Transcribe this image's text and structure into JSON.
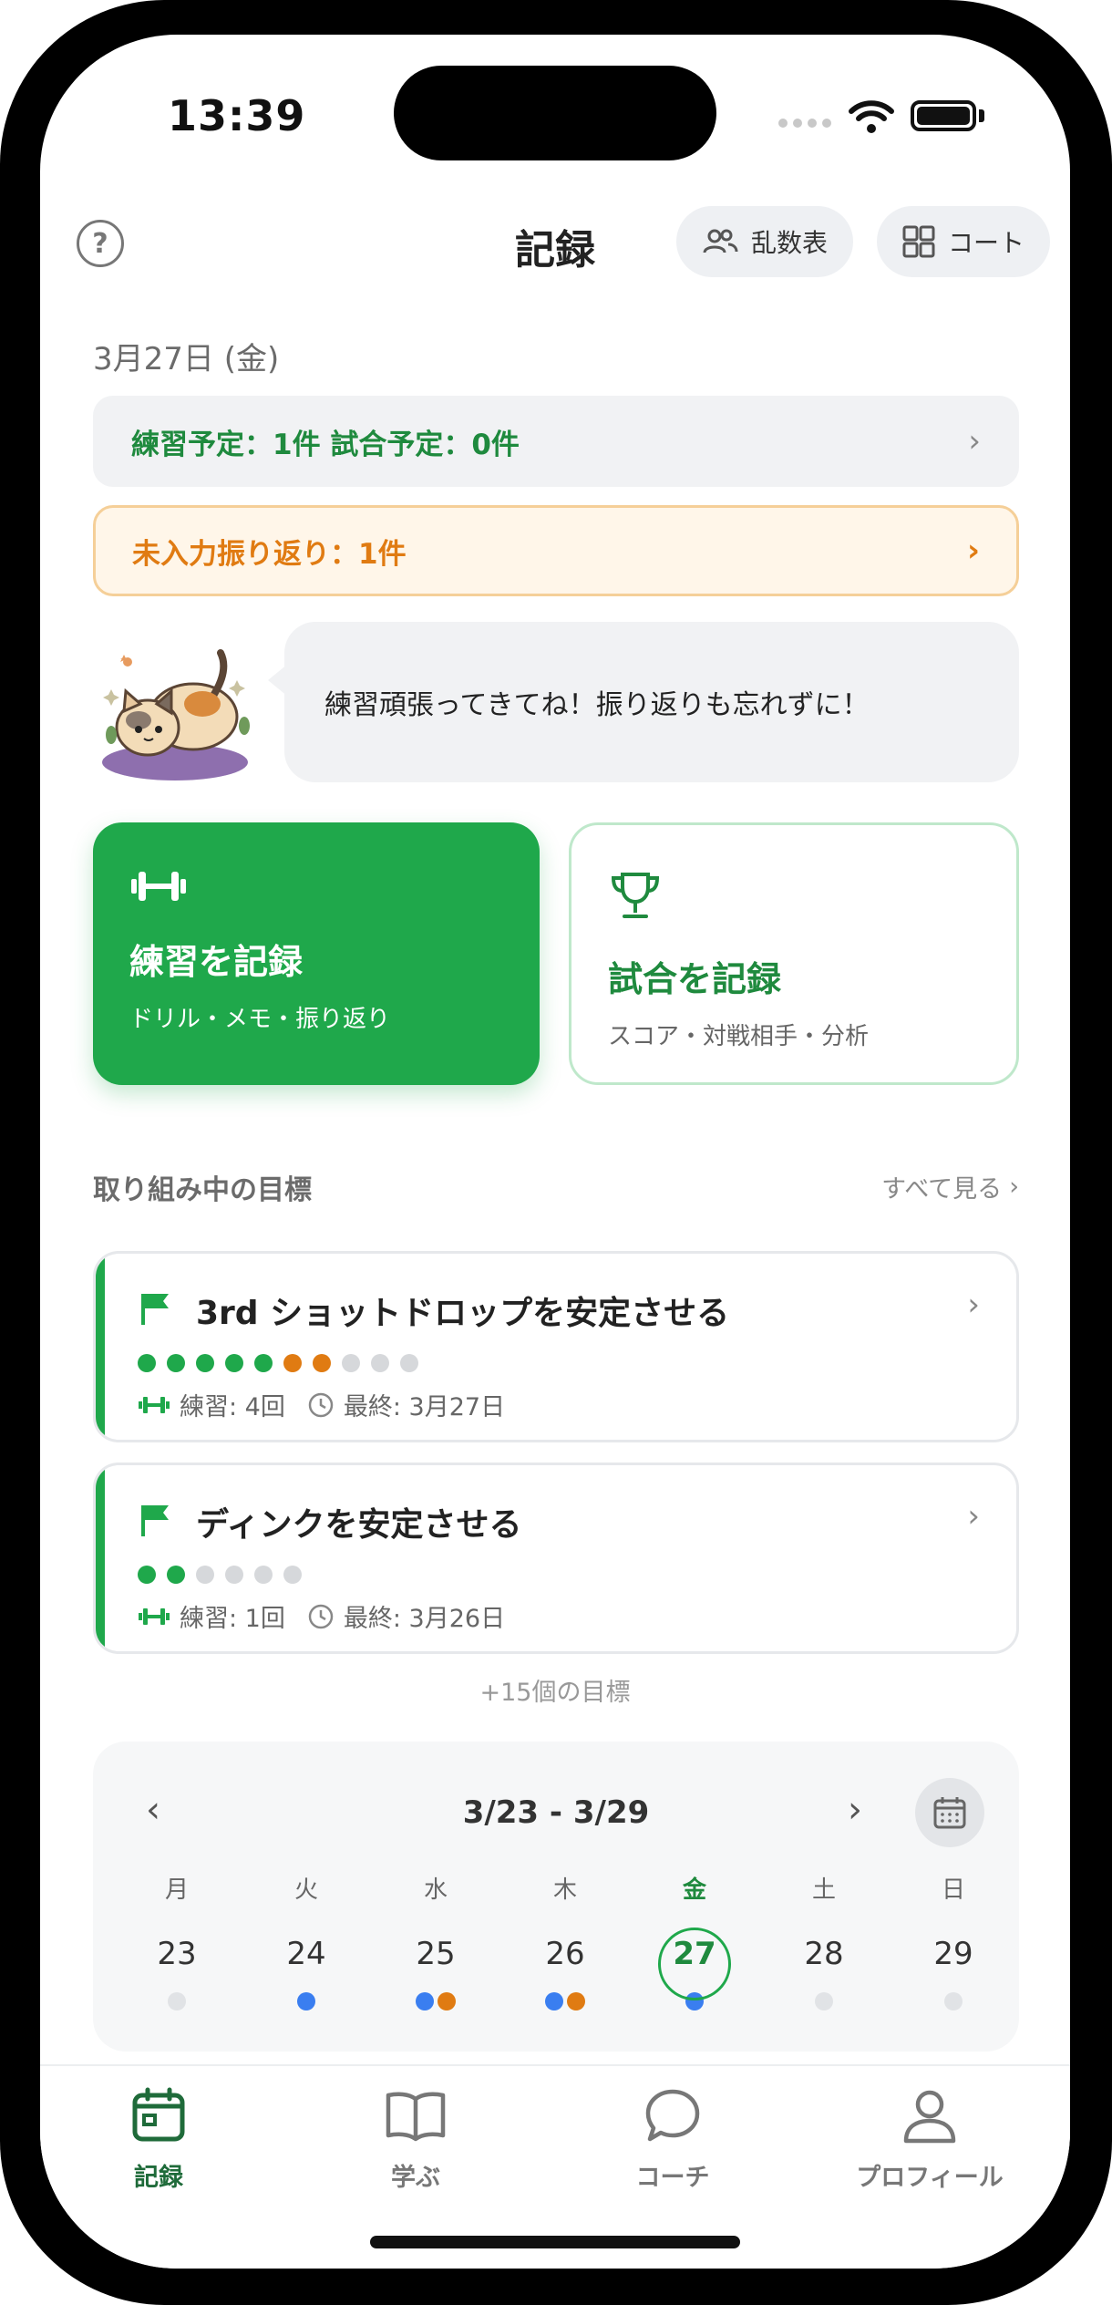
{
  "status": {
    "time": "13:39"
  },
  "header": {
    "title": "記録",
    "random_table_label": "乱数表",
    "court_label": "コート"
  },
  "date_label": "3月27日 (金)",
  "schedule_banner": "練習予定：1件  試合予定：0件",
  "reflection_banner": "未入力振り返り：1件",
  "mascot_message": "練習頑張ってきてね！振り返りも忘れずに！",
  "actions": {
    "practice": {
      "title": "練習を記録",
      "subtitle": "ドリル・メモ・振り返り"
    },
    "match": {
      "title": "試合を記録",
      "subtitle": "スコア・対戦相手・分析"
    }
  },
  "goals_section": {
    "title": "取り組み中の目標",
    "see_all": "すべて見る",
    "more": "+15個の目標",
    "goals": [
      {
        "title": "3rd ショットドロップを安定させる",
        "practice": "練習: 4回",
        "last": "最終: 3月27日",
        "progress": [
          "g",
          "g",
          "g",
          "g",
          "g",
          "o",
          "o",
          "e",
          "e",
          "e"
        ]
      },
      {
        "title": "ディンクを安定させる",
        "practice": "練習: 1回",
        "last": "最終: 3月26日",
        "progress": [
          "g",
          "g",
          "e",
          "e",
          "e",
          "e"
        ]
      }
    ]
  },
  "calendar": {
    "range": "3/23 - 3/29",
    "days": [
      {
        "weekday": "月",
        "date": "23",
        "marks": [
          "grey"
        ]
      },
      {
        "weekday": "火",
        "date": "24",
        "marks": [
          "blue"
        ]
      },
      {
        "weekday": "水",
        "date": "25",
        "marks": [
          "blue",
          "orange"
        ]
      },
      {
        "weekday": "木",
        "date": "26",
        "marks": [
          "blue",
          "orange"
        ]
      },
      {
        "weekday": "金",
        "date": "27",
        "marks": [
          "blue"
        ],
        "today": true
      },
      {
        "weekday": "土",
        "date": "28",
        "marks": [
          "grey"
        ]
      },
      {
        "weekday": "日",
        "date": "29",
        "marks": [
          "grey"
        ]
      }
    ]
  },
  "tabs": [
    {
      "label": "記録",
      "icon": "calendar-icon",
      "active": true
    },
    {
      "label": "学ぶ",
      "icon": "book-icon"
    },
    {
      "label": "コーチ",
      "icon": "chat-bubble-icon"
    },
    {
      "label": "プロフィール",
      "icon": "person-icon"
    }
  ],
  "colors": {
    "accent": "#1fa84b",
    "warning": "#e07b12",
    "info": "#3a7ef0"
  }
}
